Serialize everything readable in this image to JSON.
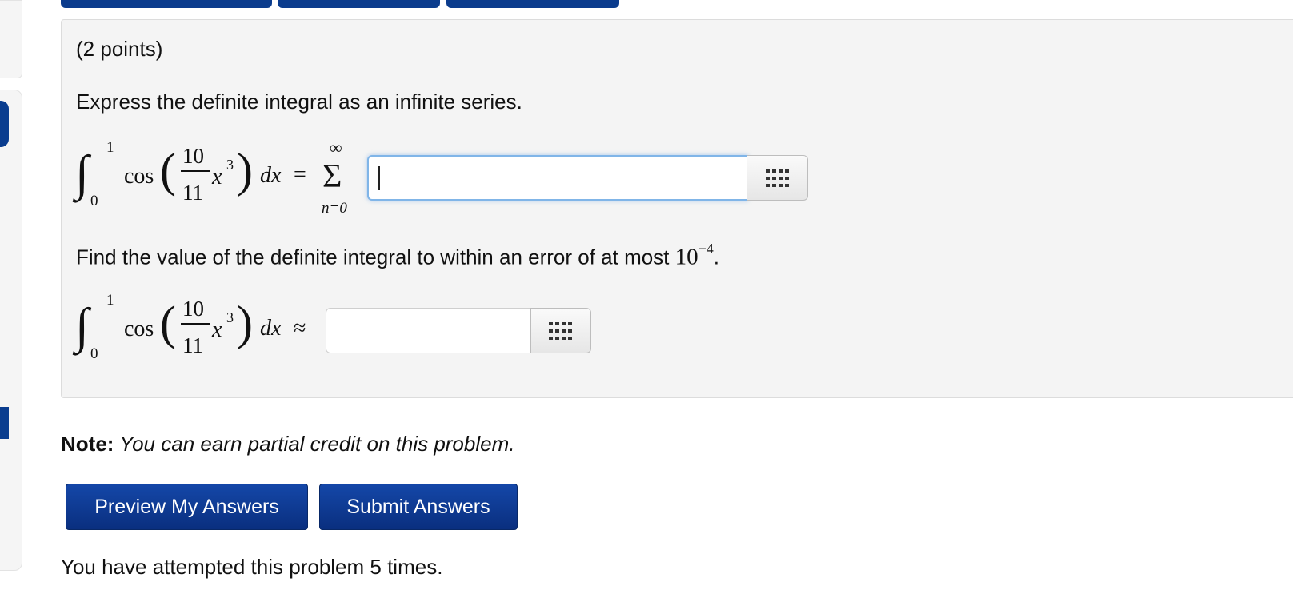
{
  "problem": {
    "points": "(2 points)",
    "instruction1": "Express the definite integral as an infinite series.",
    "instruction2_text": "Find the value of the definite integral to within an error of at most ",
    "instruction2_base": "10",
    "instruction2_exp": "−4",
    "instruction2_end": ".",
    "integral": {
      "upper": "1",
      "lower": "0",
      "func": "cos",
      "numerator": "10",
      "denominator": "11",
      "variable": "x",
      "power": "3",
      "differential": "dx"
    },
    "series": {
      "equals": "=",
      "sigma": "Σ",
      "upper": "∞",
      "lower": "n=0"
    },
    "approx": "≈",
    "answer1_value": "",
    "answer2_value": ""
  },
  "note": {
    "label": "Note:",
    "text": " You can earn partial credit on this problem."
  },
  "buttons": {
    "preview": "Preview My Answers",
    "submit": "Submit Answers"
  },
  "attempts": "You have attempted this problem 5 times.",
  "colors": {
    "button_blue": "#0a2f7f",
    "focus_glow": "#80b5e8",
    "panel_bg": "#f4f4f4"
  },
  "icons": {
    "palette": "grid-icon"
  }
}
